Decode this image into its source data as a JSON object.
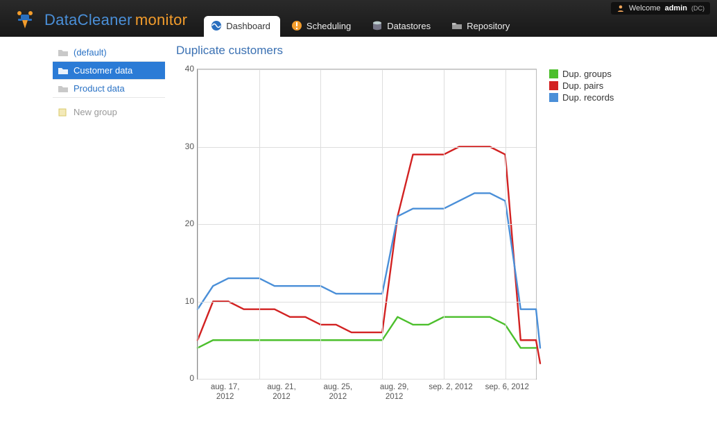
{
  "header": {
    "brand_a": "DataCleaner",
    "brand_b": "monitor",
    "welcome_prefix": "Welcome",
    "welcome_user": "admin",
    "welcome_tenant": "(DC)"
  },
  "tabs": [
    {
      "label": "Dashboard",
      "active": true
    },
    {
      "label": "Scheduling",
      "active": false
    },
    {
      "label": "Datastores",
      "active": false
    },
    {
      "label": "Repository",
      "active": false
    }
  ],
  "sidebar": {
    "items": [
      {
        "label": "(default)",
        "selected": false
      },
      {
        "label": "Customer data",
        "selected": true
      },
      {
        "label": "Product data",
        "selected": false
      }
    ],
    "new_group": "New group"
  },
  "chart_title": "Duplicate customers",
  "colors": {
    "groups": "#4cbf2c",
    "pairs": "#d22222",
    "records": "#4a8fd8"
  },
  "legend": [
    {
      "key": "groups",
      "label": "Dup. groups"
    },
    {
      "key": "pairs",
      "label": "Dup. pairs"
    },
    {
      "key": "records",
      "label": "Dup. records"
    }
  ],
  "chart_data": {
    "type": "line",
    "title": "Duplicate customers",
    "ylabel": "",
    "xlabel": "",
    "ylim": [
      0,
      40
    ],
    "y_ticks": [
      0,
      10,
      20,
      30,
      40
    ],
    "x_ticks": [
      "aug. 17,\n2012",
      "aug. 21,\n2012",
      "aug. 25,\n2012",
      "aug. 29,\n2012",
      "sep. 2, 2012",
      "sep. 6, 2012"
    ],
    "x": [
      "2012-08-17",
      "2012-08-18",
      "2012-08-19",
      "2012-08-20",
      "2012-08-21",
      "2012-08-22",
      "2012-08-23",
      "2012-08-24",
      "2012-08-25",
      "2012-08-26",
      "2012-08-27",
      "2012-08-28",
      "2012-08-29",
      "2012-08-30",
      "2012-08-31",
      "2012-09-01",
      "2012-09-02",
      "2012-09-03",
      "2012-09-04",
      "2012-09-05",
      "2012-09-06",
      "2012-09-07",
      "2012-09-08"
    ],
    "series": [
      {
        "name": "Dup. groups",
        "key": "groups",
        "values": [
          4,
          5,
          5,
          5,
          5,
          5,
          5,
          5,
          5,
          5,
          5,
          5,
          5,
          8,
          7,
          7,
          8,
          8,
          8,
          8,
          7,
          4,
          4
        ]
      },
      {
        "name": "Dup. pairs",
        "key": "pairs",
        "values": [
          5,
          10,
          10,
          9,
          9,
          9,
          8,
          8,
          7,
          7,
          6,
          6,
          6,
          21,
          29,
          29,
          29,
          30,
          30,
          30,
          29,
          5,
          5
        ]
      },
      {
        "name": "Dup. records",
        "key": "records",
        "values": [
          9,
          12,
          13,
          13,
          13,
          12,
          12,
          12,
          12,
          11,
          11,
          11,
          11,
          21,
          22,
          22,
          22,
          23,
          24,
          24,
          23,
          9,
          9
        ]
      }
    ]
  }
}
